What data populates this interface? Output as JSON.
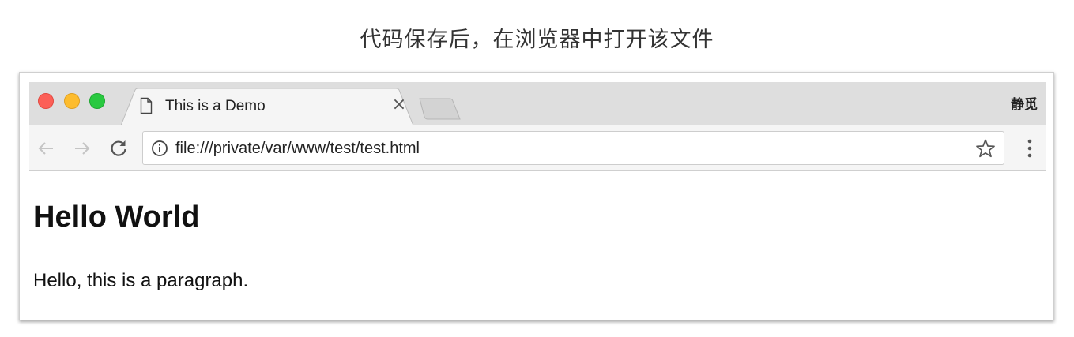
{
  "caption": "代码保存后，在浏览器中打开该文件",
  "browser": {
    "tab": {
      "title": "This is a Demo",
      "close_glyph": "×",
      "icon": "document-icon"
    },
    "profile_name": "静觅",
    "address_bar": {
      "url": "file:///private/var/www/test/test.html",
      "icon": "info-icon"
    },
    "toolbar_icons": [
      "back-arrow-icon",
      "forward-arrow-icon",
      "reload-icon",
      "star-icon",
      "menu-icon"
    ],
    "traffic_lights": {
      "red": "#fc5f57",
      "yellow": "#fdbc2e",
      "green": "#29c940"
    }
  },
  "page": {
    "heading": "Hello World",
    "paragraph": "Hello, this is a paragraph."
  }
}
